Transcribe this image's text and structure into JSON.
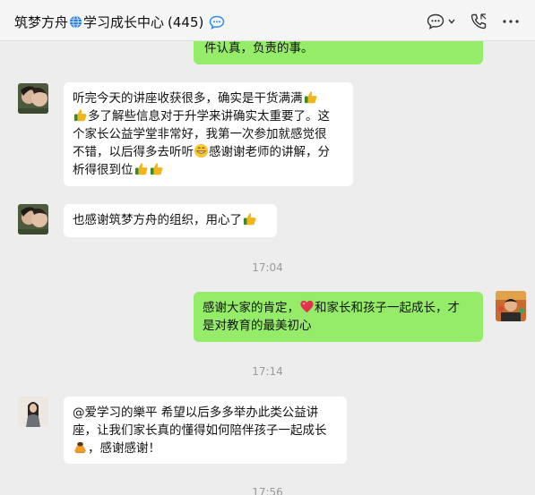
{
  "header": {
    "name_part1": "筑梦方舟",
    "name_part2": "学习成长中心",
    "member_count": "(445)",
    "icons": [
      "globe-icon",
      "chat-dots-icon",
      "speech-bubble-icon",
      "chevron-down-icon",
      "phone-icon",
      "more-icon"
    ]
  },
  "messages": {
    "m0_tail": "件认真，负责的事。",
    "m1": {
      "l1": "听完今天的讲座收获很多，确实是干货满满",
      "l2": "多了解些信息对于升学来讲确实太重要了。这",
      "l3": "个家长公益学堂非常好，我第一次参加就感觉很",
      "l4a": "不错，以后得多去听听",
      "l4b": "感谢谢老师的讲解，分",
      "l5": "析得很到位"
    },
    "m2": {
      "text": "也感谢筑梦方舟的组织，用心了"
    },
    "t1": "17:04",
    "m3": {
      "l1a": "感谢大家的肯定，",
      "l1b": "和家长和孩子一起成长，才",
      "l2": "是对教育的最美初心"
    },
    "t2": "17:14",
    "m4": {
      "l1": "@爱学习的樂平  希望以后多多举办此类公益讲",
      "l2": "座，让我们家长真的懂得如何陪伴孩子一起成长",
      "l3": "，感谢感谢！"
    },
    "t3": "17:56"
  },
  "colors": {
    "bubble_self": "#95ec69",
    "bubble_other": "#ffffff",
    "background": "#ededed",
    "timestamp": "#9a9a9a"
  }
}
